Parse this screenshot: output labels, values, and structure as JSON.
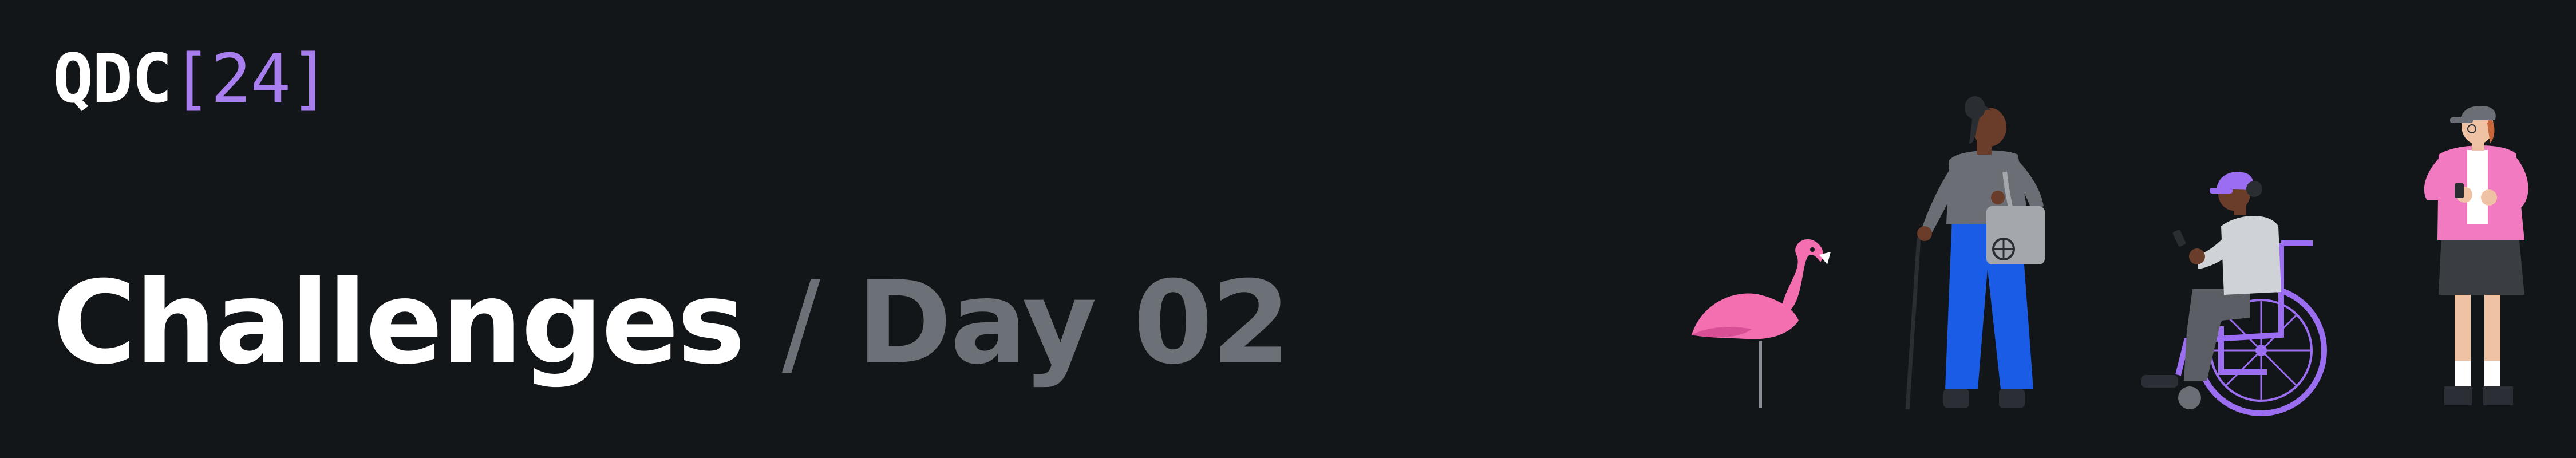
{
  "logo": {
    "name": "QDC",
    "bracket": "[24]"
  },
  "heading": {
    "main": "Challenges",
    "separator": "/",
    "sub": "Day 02"
  },
  "colors": {
    "background": "#131619",
    "accent": "#a97ff0",
    "muted_text": "#6c7178",
    "flamingo_pink": "#f46fb0",
    "blue_pants": "#1a5ce6",
    "purple_wheelchair": "#9b6df0",
    "pink_shirt": "#f27ac1"
  },
  "icons": [
    "flamingo-figure",
    "person-with-cane-figure",
    "person-in-wheelchair-figure",
    "person-with-phone-figure"
  ]
}
